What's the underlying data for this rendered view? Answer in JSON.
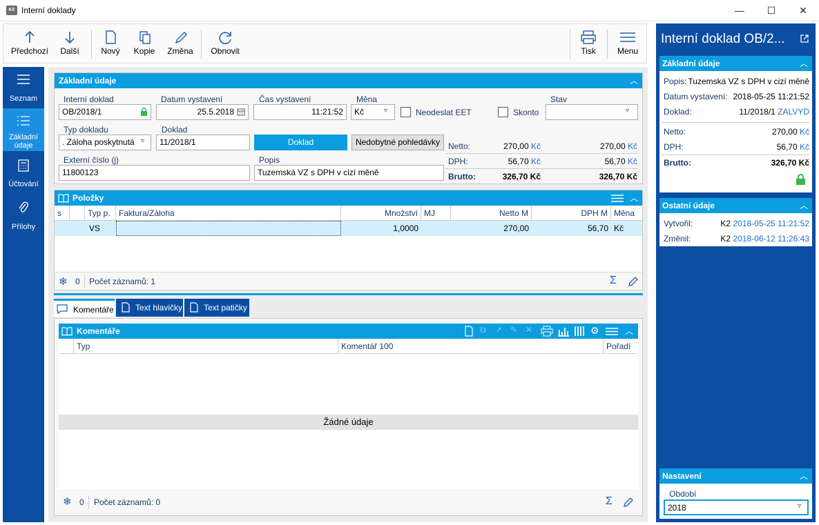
{
  "window": {
    "title": "Interní doklady",
    "icon_text": "Kč"
  },
  "toolbar": {
    "previous": "Předchozí",
    "next": "Další",
    "new": "Nový",
    "copy": "Kopie",
    "change": "Změna",
    "refresh": "Obnovit",
    "print": "Tisk",
    "menu": "Menu"
  },
  "nav": {
    "list": "Seznam",
    "basic_1": "Základní",
    "basic_2": "údaje",
    "accounting": "Účtování",
    "attachments": "Přílohy"
  },
  "basic": {
    "header": "Základní údaje",
    "internal_doc_label": "Interní doklad",
    "internal_doc_value": "OB/2018/1",
    "issue_date_label": "Datum vystavení",
    "issue_date_value": "25.5.2018",
    "issue_time_label": "Čas vystavení",
    "issue_time_value": "11:21:52",
    "currency_label": "Měna",
    "currency_value": "Kč",
    "no_eet_label": "Neodeslat EET",
    "discount_label": "Skonto",
    "state_label": "Stav",
    "state_value": "",
    "doc_type_label": "Typ dokladu",
    "doc_type_value": ". Záloha poskytnutá",
    "document_label": "Doklad",
    "document_value": "11/2018/1",
    "document_button": "Doklad",
    "bad_debts_button": "Nedobytné pohledávky",
    "external_no_label": "Externí číslo (j)",
    "external_no_value": "11800123",
    "description_label": "Popis",
    "description_value": "Tuzemská VZ s DPH v cizí měně",
    "totals": {
      "net_label": "Netto:",
      "vat_label": "DPH:",
      "gross_label": "Brutto:",
      "net_1": "270,00",
      "vat_1": "56,70",
      "gross_1": "326,70",
      "net_2": "270,00",
      "vat_2": "56,70",
      "gross_2": "326,70",
      "cur": "Kč"
    }
  },
  "items": {
    "header": "Položky",
    "columns": [
      "s",
      "",
      "Typ p.",
      "Faktura/Záloha",
      "Množství",
      "MJ",
      "Netto M",
      "DPH M",
      "Měna"
    ],
    "row": {
      "type": "VS",
      "invoice": "",
      "qty": "1,0000",
      "unit": "",
      "net": "270,00",
      "vat": "56,70",
      "cur": "Kč"
    },
    "footer_count": "0",
    "footer_records": "Počet záznamů: 1"
  },
  "tabs": {
    "comments": "Komentáře",
    "header_text": "Text hlavičky",
    "footer_text": "Text patičky"
  },
  "comments": {
    "header": "Komentáře",
    "columns": [
      "Typ",
      "Komentář 100",
      "Pořadí"
    ],
    "empty": "Žádné údaje",
    "footer_count": "0",
    "footer_records": "Počet záznamů: 0"
  },
  "right": {
    "title": "Interní doklad OB/2...",
    "basic_header": "Základní údaje",
    "desc_label": "Popis:",
    "desc_value": "Tuzemská VZ s DPH v cizí měně",
    "date_label": "Datum vystavení:",
    "date_value": "2018-05-25 11:21:52",
    "doc_label": "Doklad:",
    "doc_value": "11/2018/1",
    "doc_state": "ZALVYD",
    "net_label": "Netto:",
    "net_value": "270,00",
    "cur": "Kč",
    "vat_label": "DPH:",
    "vat_value": "56,70",
    "gross_label": "Brutto:",
    "gross_value": "326,70",
    "other_header": "Ostatní údaje",
    "created_label": "Vytvořil:",
    "created_user": "K2",
    "created_date": "2018-05-25 11:21:52",
    "changed_label": "Změnil:",
    "changed_user": "K2",
    "changed_date": "2018-06-12 11:26:43",
    "settings_header": "Nastavení",
    "period_label": "Období",
    "period_value": "2018"
  },
  "colors": {
    "accent": "#0c9ddf",
    "nav": "#0c4ea2",
    "lock": "#3db54a"
  }
}
